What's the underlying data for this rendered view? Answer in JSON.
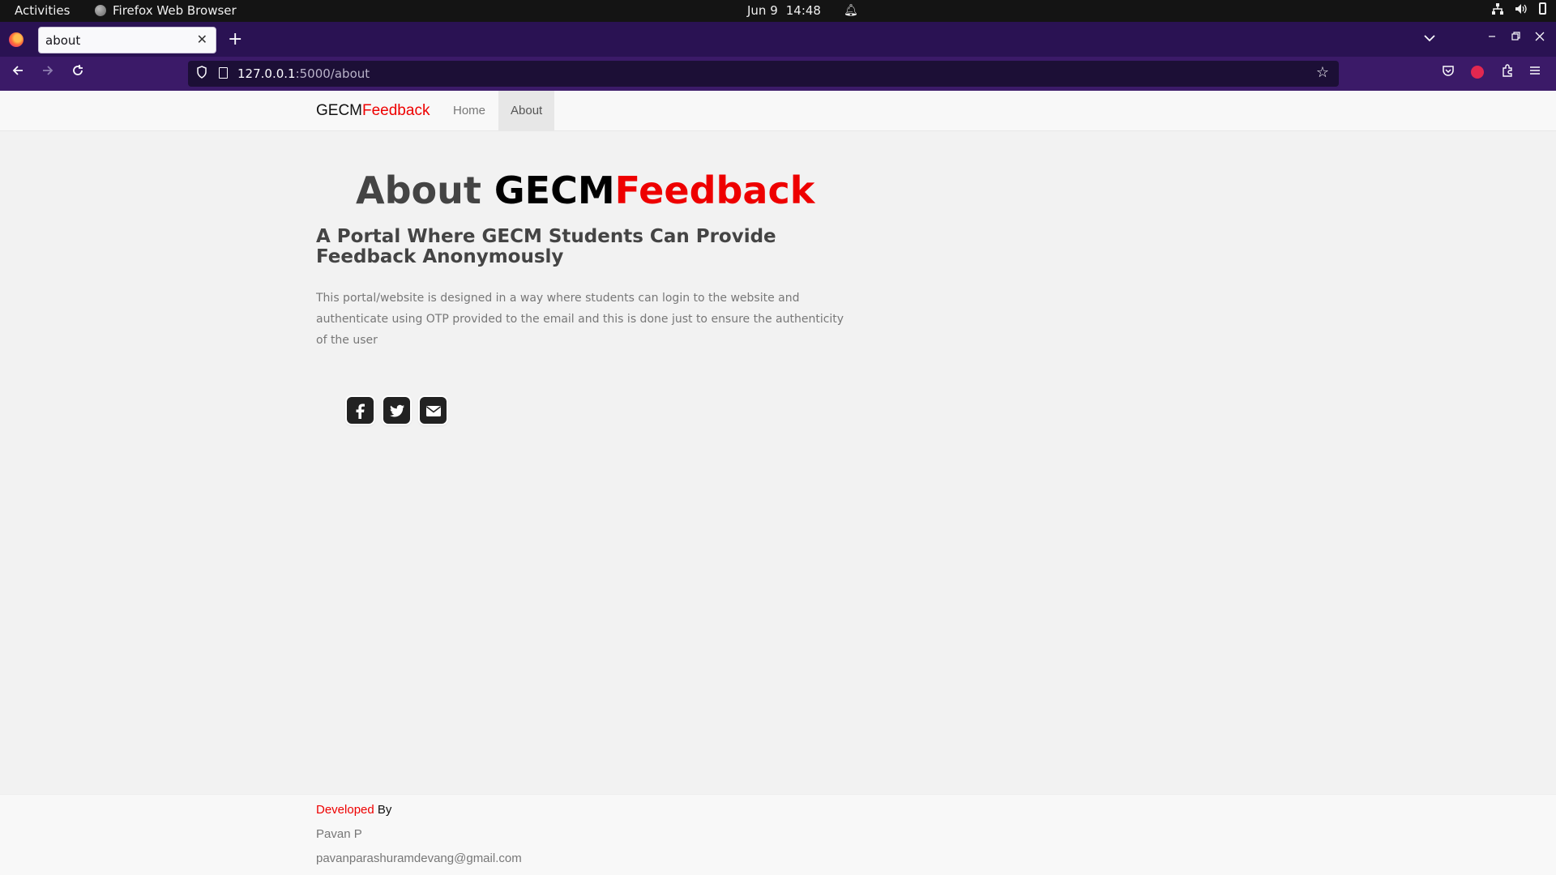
{
  "system_bar": {
    "activities": "Activities",
    "app_name": "Firefox Web Browser",
    "date": "Jun 9",
    "time": "14:48"
  },
  "browser": {
    "tab_title": "about",
    "url_host": "127.0.0.1",
    "url_path": ":5000/about",
    "new_tab_glyph": "+",
    "close_tab_glyph": "✕"
  },
  "site": {
    "brand_part1": "GECM",
    "brand_part2": "Feedback",
    "nav": [
      {
        "label": "Home",
        "active": false
      },
      {
        "label": "About",
        "active": true
      }
    ]
  },
  "about": {
    "title_part1": "About ",
    "title_part2": "GECM",
    "title_part3": "Feedback",
    "subtitle": "A Portal Where GECM Students Can Provide Feedback Anonymously",
    "description": "This portal/website is designed in a way where students can login to the website and authenticate using OTP provided to the email and this is done just to ensure the authenticity of the user"
  },
  "social": [
    {
      "icon": "facebook-icon"
    },
    {
      "icon": "twitter-icon"
    },
    {
      "icon": "envelope-icon"
    }
  ],
  "footer": {
    "developed": "Developed",
    "by": " By",
    "name": "Pavan P",
    "email": "pavanparashuramdevang@gmail.com"
  },
  "colors": {
    "brand_red": "#ee0000",
    "tab_bar": "#2a1253",
    "toolbar": "#3b1a68"
  }
}
